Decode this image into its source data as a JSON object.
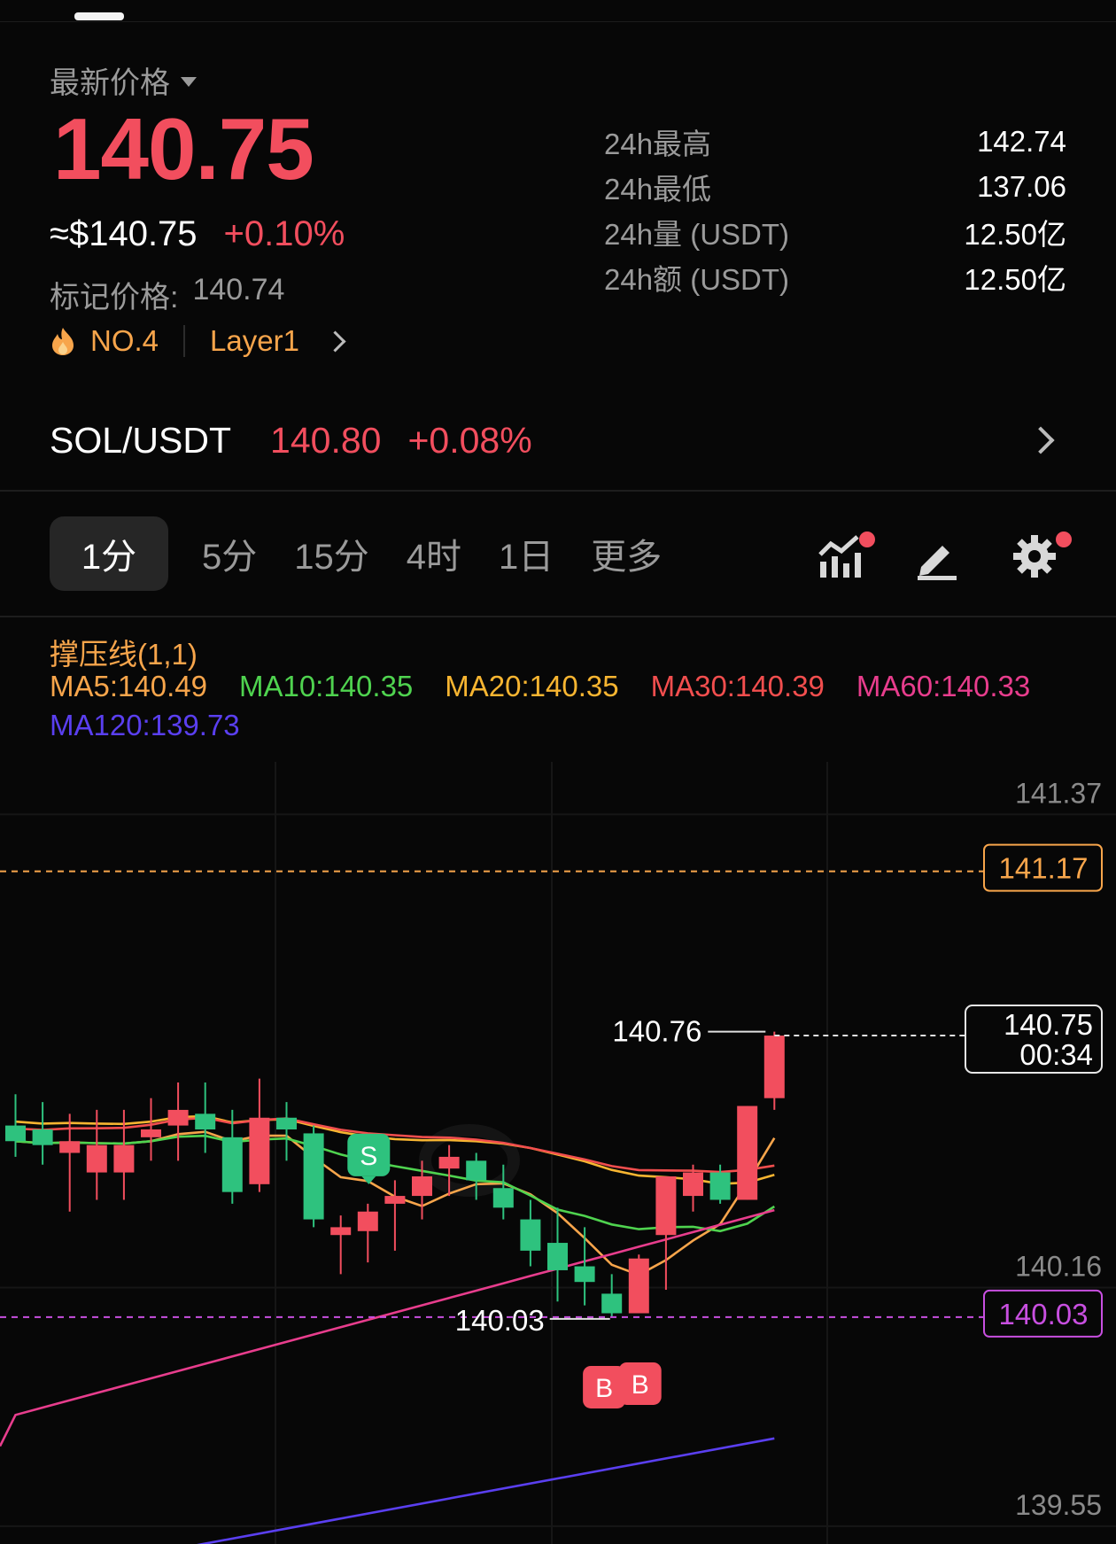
{
  "header": {
    "price_label": "最新价格",
    "last_price": "140.75",
    "usd_price": "≈$140.75",
    "usd_change": "+0.10%",
    "mark_label": "标记价格:",
    "mark_value": "140.74",
    "rank": "NO.4",
    "category": "Layer1"
  },
  "stats": [
    {
      "label": "24h最高",
      "value": "142.74"
    },
    {
      "label": "24h最低",
      "value": "137.06"
    },
    {
      "label": "24h量 (USDT)",
      "value": "12.50亿"
    },
    {
      "label": "24h额 (USDT)",
      "value": "12.50亿"
    }
  ],
  "pair": {
    "name": "SOL/USDT",
    "price": "140.80",
    "change": "+0.08%"
  },
  "tabs": [
    "1分",
    "5分",
    "15分",
    "4时",
    "1日",
    "更多"
  ],
  "active_tab": "1分",
  "indicator": {
    "title": "撑压线(1,1)",
    "ma": [
      {
        "label": "MA5:140.49",
        "color": "#f7a54b"
      },
      {
        "label": "MA10:140.35",
        "color": "#4fd34f"
      },
      {
        "label": "MA20:140.35",
        "color": "#f7b531"
      },
      {
        "label": "MA30:140.39",
        "color": "#f24e4e"
      },
      {
        "label": "MA60:140.33",
        "color": "#e83d8d"
      }
    ],
    "ma120": {
      "label": "MA120:139.73",
      "color": "#5a3ff0"
    }
  },
  "colors": {
    "up": "#f24e5e",
    "down": "#2ec27e",
    "accent": "#f7a54b",
    "support": "#c84fe0"
  },
  "chart_data": {
    "type": "candlestick",
    "y_axis_labels": [
      "141.37",
      "140.16",
      "139.55"
    ],
    "resistance": "141.17",
    "support": "140.03",
    "last_price": "140.75",
    "countdown": "00:34",
    "high_mark": "140.76",
    "low_mark": "140.03",
    "signals": [
      {
        "type": "S"
      },
      {
        "type": "B"
      },
      {
        "type": "B"
      }
    ],
    "ylim": [
      139.45,
      141.45
    ],
    "candles": [
      {
        "o": 140.52,
        "h": 140.6,
        "l": 140.44,
        "c": 140.48
      },
      {
        "o": 140.51,
        "h": 140.58,
        "l": 140.42,
        "c": 140.47
      },
      {
        "o": 140.45,
        "h": 140.55,
        "l": 140.3,
        "c": 140.48
      },
      {
        "o": 140.4,
        "h": 140.56,
        "l": 140.33,
        "c": 140.47
      },
      {
        "o": 140.4,
        "h": 140.56,
        "l": 140.33,
        "c": 140.47
      },
      {
        "o": 140.49,
        "h": 140.59,
        "l": 140.43,
        "c": 140.51
      },
      {
        "o": 140.52,
        "h": 140.63,
        "l": 140.43,
        "c": 140.56
      },
      {
        "o": 140.55,
        "h": 140.63,
        "l": 140.45,
        "c": 140.51
      },
      {
        "o": 140.49,
        "h": 140.56,
        "l": 140.32,
        "c": 140.35
      },
      {
        "o": 140.37,
        "h": 140.64,
        "l": 140.35,
        "c": 140.54
      },
      {
        "o": 140.54,
        "h": 140.58,
        "l": 140.43,
        "c": 140.51
      },
      {
        "o": 140.5,
        "h": 140.52,
        "l": 140.26,
        "c": 140.28
      },
      {
        "o": 140.24,
        "h": 140.29,
        "l": 140.14,
        "c": 140.26
      },
      {
        "o": 140.25,
        "h": 140.32,
        "l": 140.17,
        "c": 140.3
      },
      {
        "o": 140.32,
        "h": 140.38,
        "l": 140.2,
        "c": 140.34
      },
      {
        "o": 140.34,
        "h": 140.43,
        "l": 140.28,
        "c": 140.39
      },
      {
        "o": 140.41,
        "h": 140.47,
        "l": 140.34,
        "c": 140.44
      },
      {
        "o": 140.43,
        "h": 140.45,
        "l": 140.33,
        "c": 140.38
      },
      {
        "o": 140.36,
        "h": 140.42,
        "l": 140.28,
        "c": 140.31
      },
      {
        "o": 140.28,
        "h": 140.33,
        "l": 140.16,
        "c": 140.2
      },
      {
        "o": 140.22,
        "h": 140.31,
        "l": 140.07,
        "c": 140.15
      },
      {
        "o": 140.16,
        "h": 140.26,
        "l": 140.06,
        "c": 140.12
      },
      {
        "o": 140.09,
        "h": 140.14,
        "l": 140.03,
        "c": 140.04
      },
      {
        "o": 140.04,
        "h": 140.19,
        "l": 140.04,
        "c": 140.18
      },
      {
        "o": 140.24,
        "h": 140.39,
        "l": 140.1,
        "c": 140.39
      },
      {
        "o": 140.34,
        "h": 140.42,
        "l": 140.3,
        "c": 140.4
      },
      {
        "o": 140.4,
        "h": 140.42,
        "l": 140.32,
        "c": 140.33
      },
      {
        "o": 140.33,
        "h": 140.57,
        "l": 140.33,
        "c": 140.57
      },
      {
        "o": 140.59,
        "h": 140.76,
        "l": 140.56,
        "c": 140.75
      }
    ]
  }
}
